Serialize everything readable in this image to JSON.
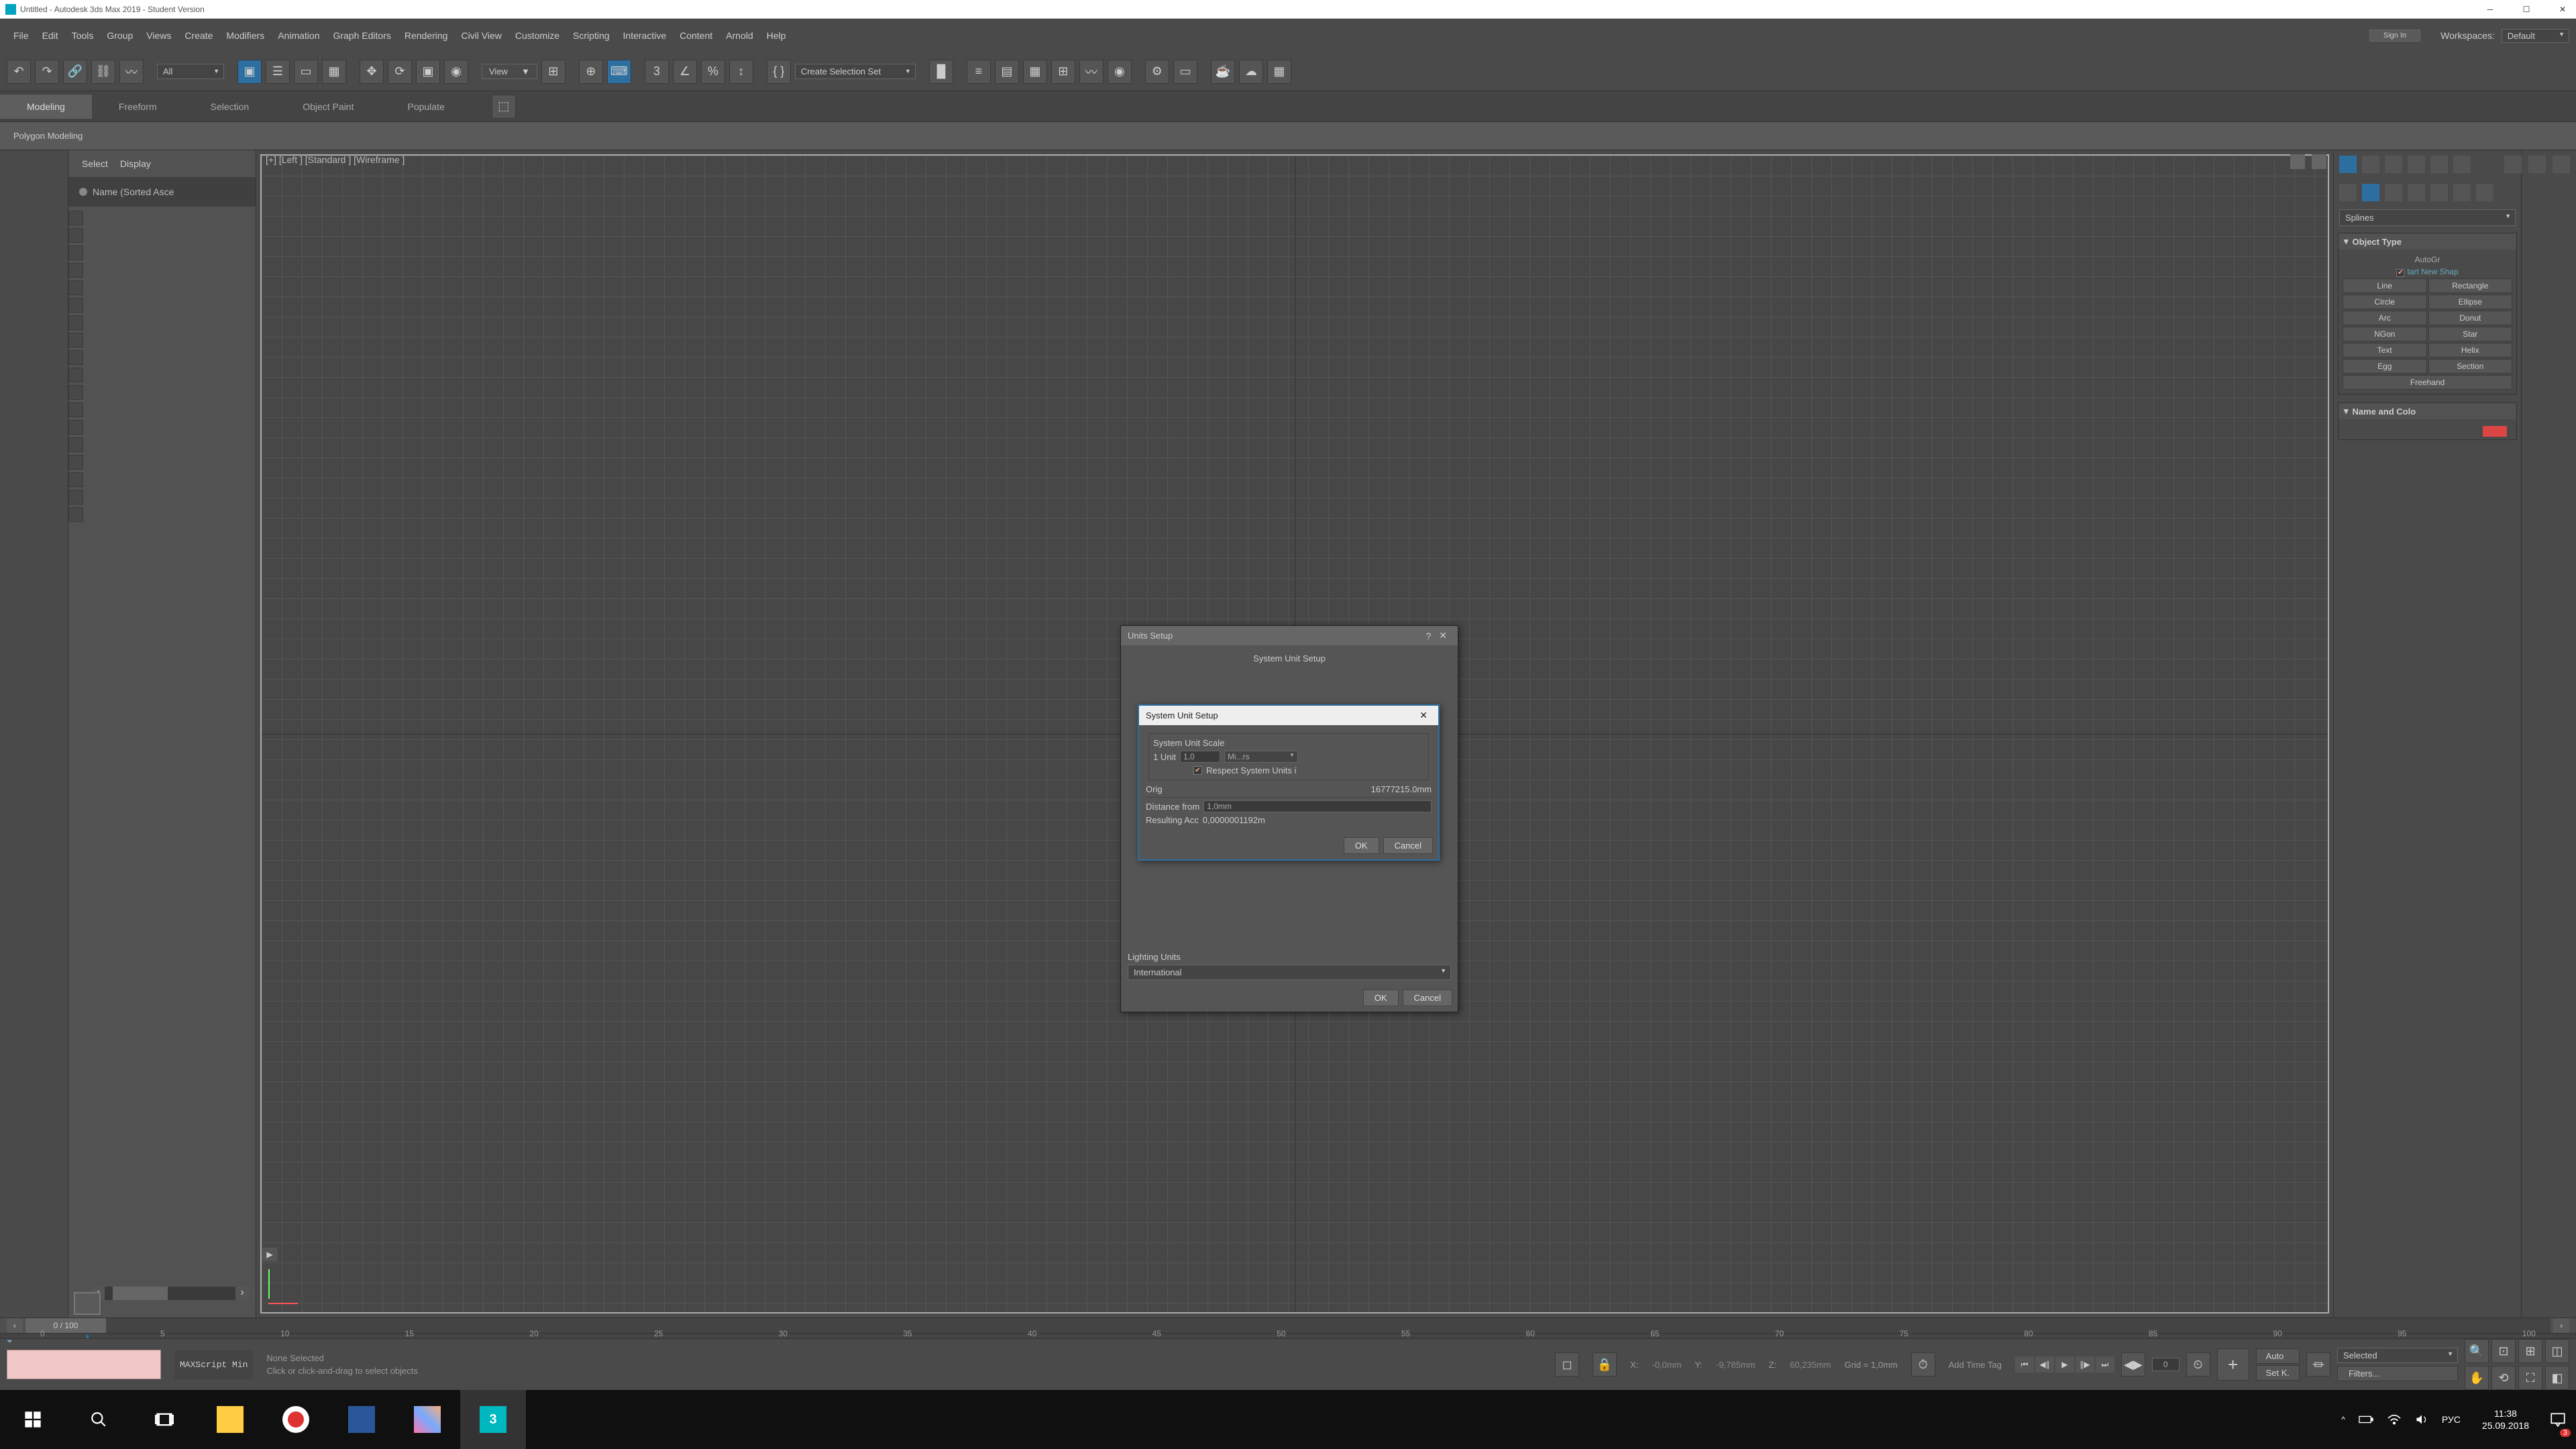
{
  "titlebar": {
    "title": "Untitled - Autodesk 3ds Max 2019 - Student Version"
  },
  "menubar": {
    "items": [
      "File",
      "Edit",
      "Tools",
      "Group",
      "Views",
      "Create",
      "Modifiers",
      "Animation",
      "Graph Editors",
      "Rendering",
      "Civil View",
      "Customize",
      "Scripting",
      "Interactive",
      "Content",
      "Arnold",
      "Help"
    ],
    "signin": "Sign In",
    "workspaces_label": "Workspaces:",
    "workspaces_value": "Default"
  },
  "toolbar": {
    "filter": "All",
    "view_label": "View",
    "selection_set": "Create Selection Set"
  },
  "ribbon": {
    "tabs": [
      "Modeling",
      "Freeform",
      "Selection",
      "Object Paint",
      "Populate"
    ]
  },
  "ribbon2": {
    "label": "Polygon Modeling"
  },
  "scene_explorer": {
    "select": "Select",
    "display": "Display",
    "name_header": "Name (Sorted Asce"
  },
  "viewport": {
    "label": "[+] [Left ]  [Standard ]  [Wireframe ]"
  },
  "cmd_panel": {
    "category": "Splines",
    "object_type": "Object Type",
    "autogrid": "AutoGr",
    "start_new_shape": "tart New Shap",
    "buttons": [
      "Line",
      "Rectangle",
      "Circle",
      "Ellipse",
      "Arc",
      "Donut",
      "NGon",
      "Star",
      "Text",
      "Helix",
      "Egg",
      "Section"
    ],
    "freehand": "Freehand",
    "name_and_color": "Name and Colo"
  },
  "units_dialog": {
    "title": "Units Setup",
    "system_unit_setup_btn": "System Unit Setup",
    "lighting_units": "Lighting Units",
    "lighting_value": "International",
    "ok": "OK",
    "cancel": "Cancel"
  },
  "system_unit_dialog": {
    "title": "System Unit Setup",
    "scale_label": "System Unit Scale",
    "one_unit": "1 Unit",
    "one_unit_val": "1,0",
    "unit_type": "Mi...rs",
    "respect": "Respect System Units i",
    "orig": "Orig",
    "orig_val": "16777215.0mm",
    "dist_label": "Distance from",
    "dist_val": "1,0mm",
    "acc_label": "Resulting Acc",
    "acc_val": "0,0000001192m",
    "ok": "OK",
    "cancel": "Cancel"
  },
  "timeline": {
    "frame_display": "0 / 100",
    "ticks": [
      "0",
      "5",
      "10",
      "15",
      "20",
      "25",
      "30",
      "35",
      "40",
      "45",
      "50",
      "55",
      "60",
      "65",
      "70",
      "75",
      "80",
      "85",
      "90",
      "95",
      "100"
    ]
  },
  "status": {
    "maxscript": "MAXScript Min",
    "none_selected": "None Selected",
    "prompt": "Click or click-and-drag to select objects",
    "x_label": "X:",
    "x_val": "-0,0mm",
    "y_label": "Y:",
    "y_val": "-9,785mm",
    "z_label": "Z:",
    "z_val": "60,235mm",
    "grid": "Grid = 1,0mm",
    "add_time_tag": "Add Time Tag",
    "auto": "Auto",
    "setk": "Set K.",
    "frame_spin": "0",
    "selected": "Selected",
    "filters": "Filters..."
  },
  "taskbar": {
    "lang": "РУС",
    "time": "11:38",
    "date": "25.09.2018",
    "notif_count": "3"
  }
}
